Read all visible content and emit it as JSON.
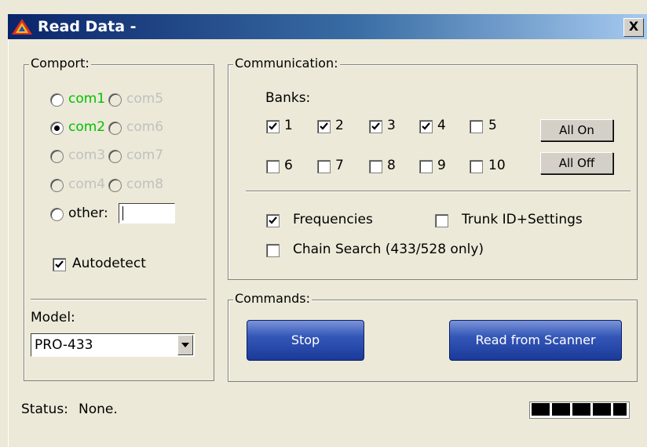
{
  "window": {
    "title": "Read Data -",
    "close_label": "X"
  },
  "comport": {
    "legend": "Comport:",
    "options": [
      "com1",
      "com2",
      "com3",
      "com4",
      "com5",
      "com6",
      "com7",
      "com8"
    ],
    "selected": "com2",
    "other_label": "other:",
    "other_value": "",
    "autodetect_label": "Autodetect",
    "autodetect_checked": true
  },
  "model": {
    "label": "Model:",
    "value": "PRO-433"
  },
  "communication": {
    "legend": "Communication:",
    "banks_label": "Banks:",
    "banks": [
      "1",
      "2",
      "3",
      "4",
      "5",
      "6",
      "7",
      "8",
      "9",
      "10"
    ],
    "banks_checked": [
      true,
      true,
      true,
      true,
      false,
      false,
      false,
      false,
      false,
      false
    ],
    "all_on_label": "All On",
    "all_off_label": "All Off",
    "frequencies_label": "Frequencies",
    "frequencies_checked": true,
    "trunk_label": "Trunk ID+Settings",
    "trunk_checked": false,
    "chain_label": "Chain Search (433/528 only)",
    "chain_checked": false
  },
  "commands": {
    "legend": "Commands:",
    "stop_label": "Stop",
    "read_label": "Read from Scanner"
  },
  "status": {
    "label": "Status:",
    "value": "None."
  },
  "colors": {
    "active_com": "#00c000",
    "disabled_com": "#c0c0c0",
    "button_blue": "#1b3a99"
  }
}
